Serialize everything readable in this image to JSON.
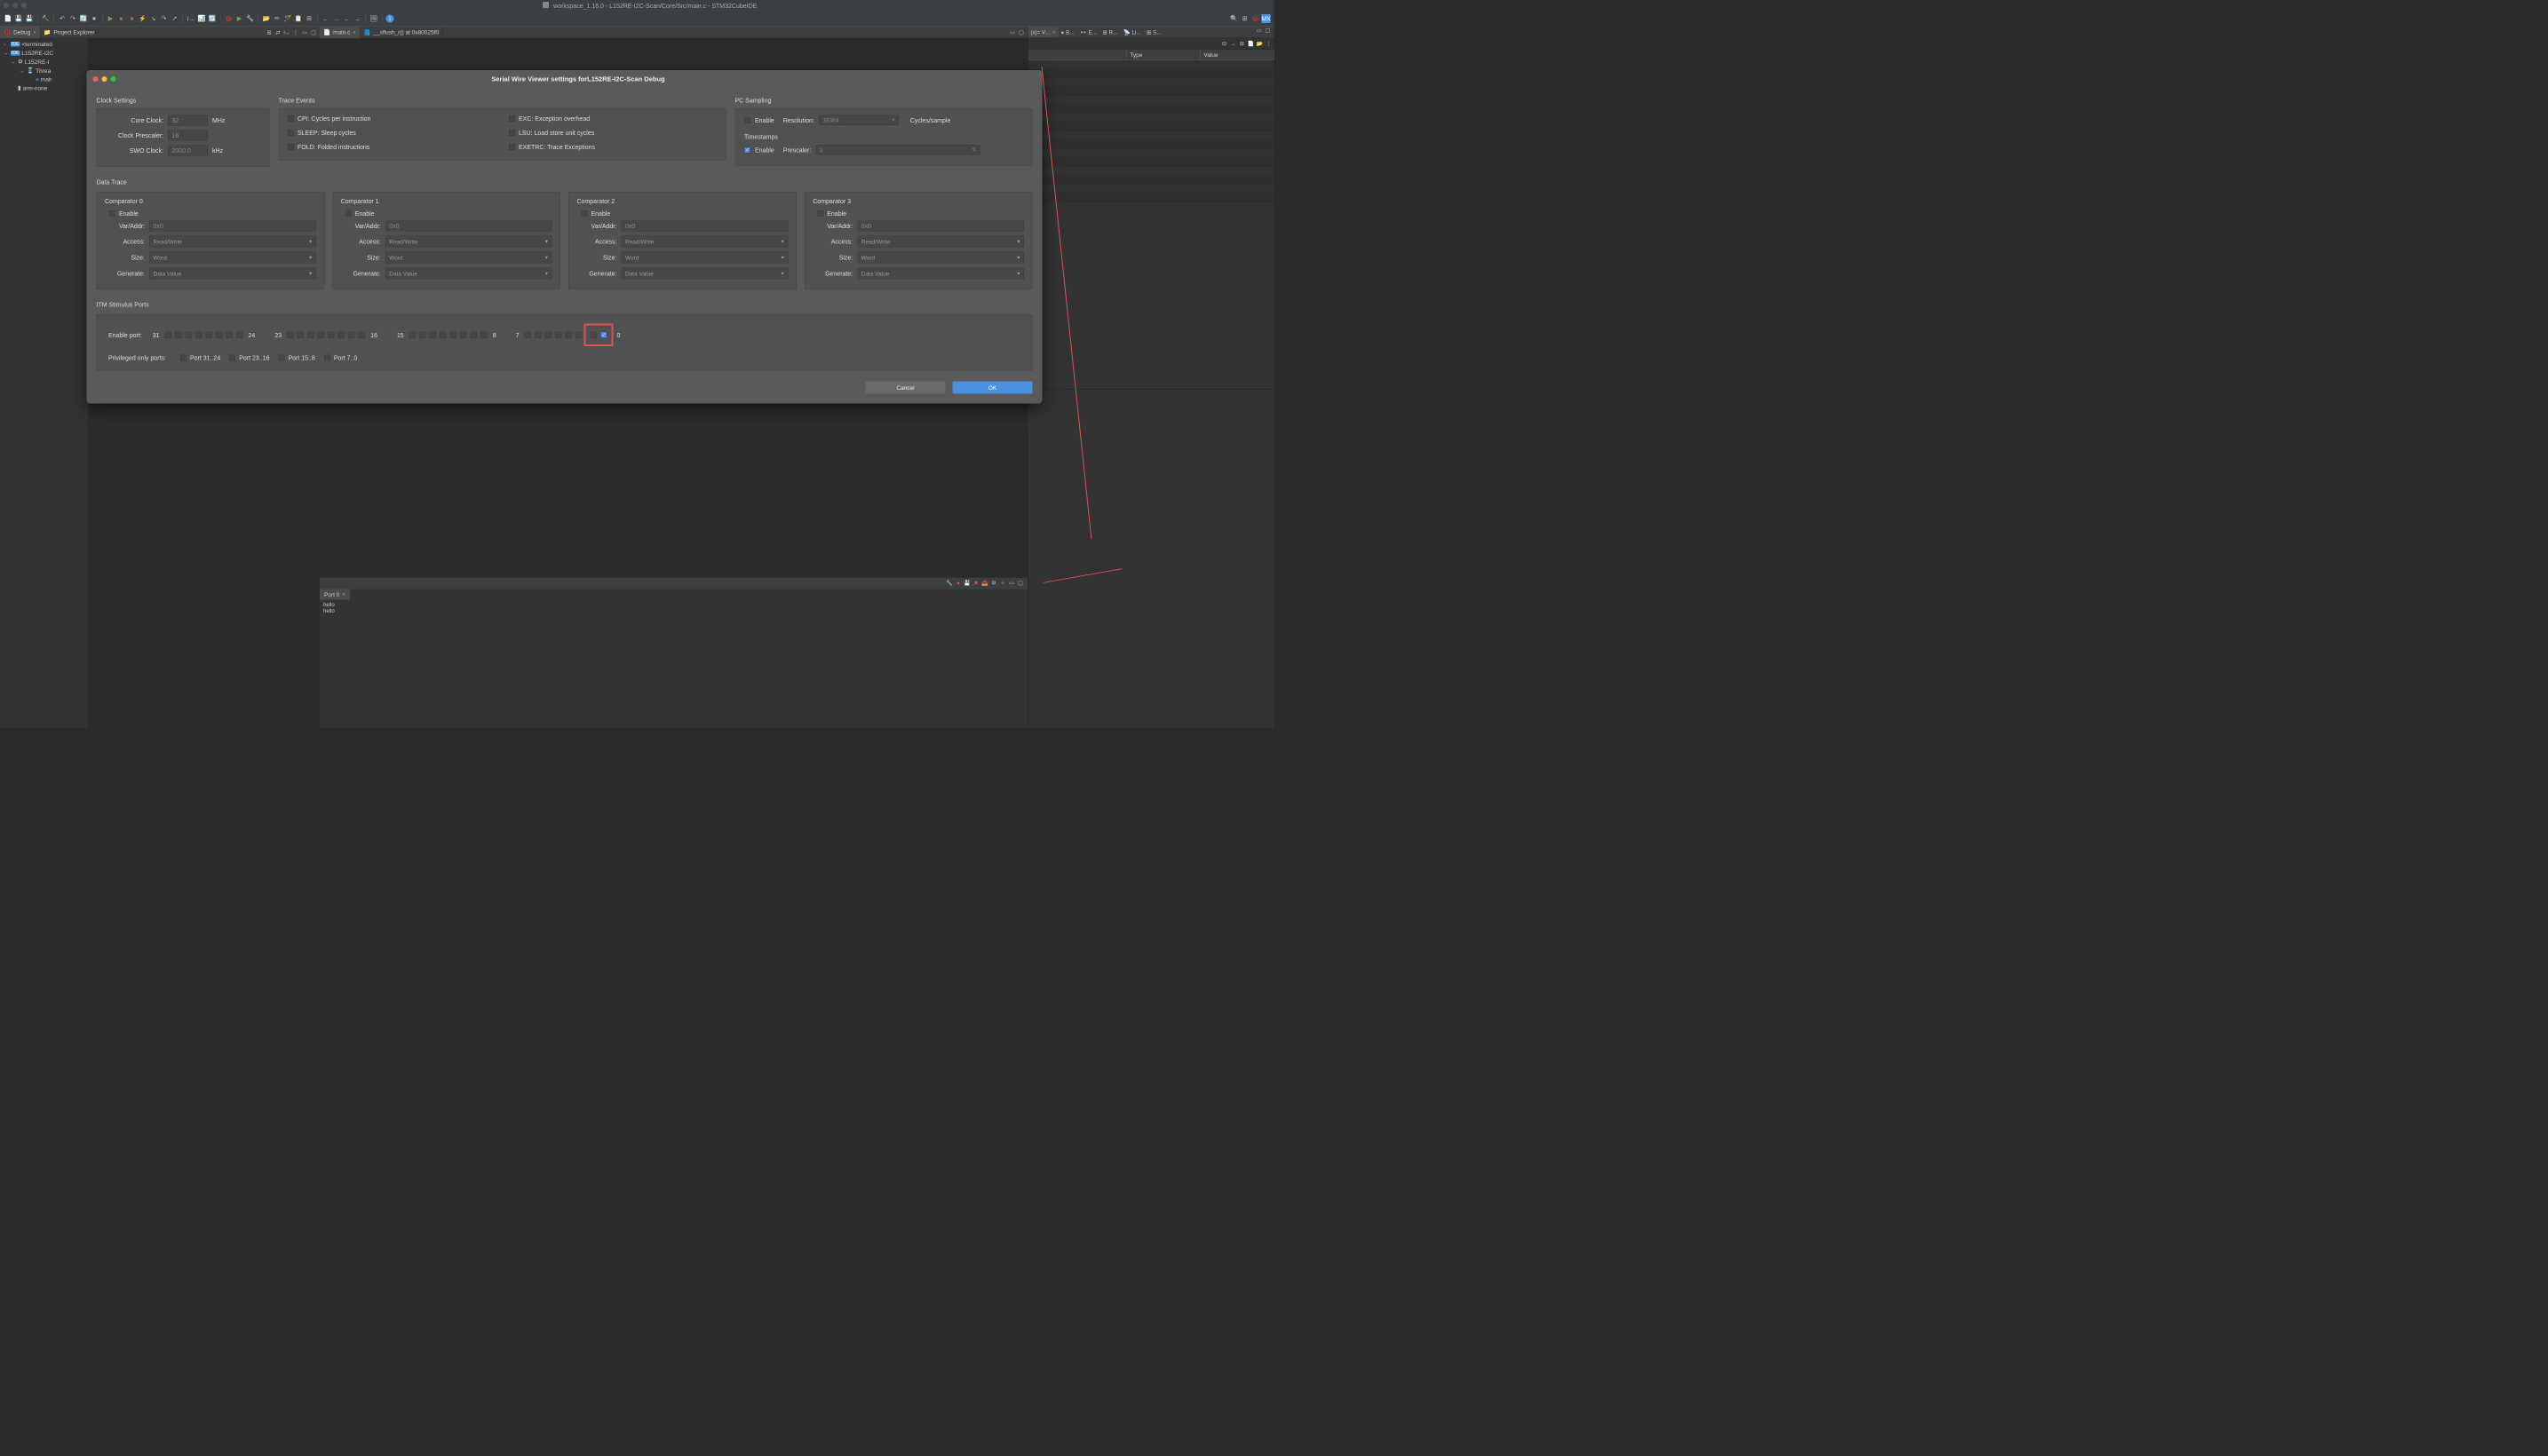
{
  "titlebar": "workspace_1.16.0 - L152RE-I2C-Scan/Core/Src/main.c - STM32CubeIDE",
  "left_tabs": {
    "debug": "Debug",
    "project_explorer": "Project Explorer"
  },
  "editor_tabs": {
    "main": "main.c",
    "sflush": "__sflush_r() at 0x80025f0"
  },
  "right_tabs": {
    "v": "V…",
    "b": "B…",
    "e": "E…",
    "r": "R…",
    "li": "Li…",
    "s": "S…"
  },
  "vars_header": {
    "c1": "",
    "c2": "Type",
    "c3": "Value"
  },
  "tree": {
    "terminated": "<terminated",
    "project": "L152RE-I2C",
    "exe": "L152RE-I",
    "thread": "Threa",
    "main": "mair",
    "arm": "arm-none"
  },
  "console_tab": "Port 0",
  "console_lines": [
    "hello",
    "hello"
  ],
  "dialog": {
    "title": "Serial Wire Viewer settings forL152RE-I2C-Scan Debug",
    "clock": {
      "section": "Clock Settings",
      "core_label": "Core Clock:",
      "core_value": "32",
      "core_unit": "MHz",
      "prescaler_label": "Clock Prescaler:",
      "prescaler_value": "16",
      "swo_label": "SWO Clock:",
      "swo_value": "2000.0",
      "swo_unit": "kHz"
    },
    "trace": {
      "section": "Trace Events",
      "cpi": "CPI: Cycles per instruction",
      "exc": "EXC: Exception overhead",
      "sleep": "SLEEP: Sleep cycles",
      "lsu": "LSU: Load store unit cycles",
      "fold": "FOLD: Folded instructions",
      "exetrc": "EXETRC: Trace Exceptions"
    },
    "pc": {
      "section": "PC Sampling",
      "enable": "Enable",
      "resolution": "Resolution:",
      "res_value": "16384",
      "suffix": "Cycles/sample"
    },
    "ts": {
      "section": "Timestamps",
      "enable": "Enable",
      "prescaler": "Prescaler:",
      "value": "1"
    },
    "data_trace": "Data Trace",
    "comp": {
      "enable": "Enable",
      "var": "Var/Addr:",
      "var_val": "0x0",
      "access": "Access:",
      "access_val": "Read/Write",
      "size": "Size:",
      "size_val": "Word",
      "generate": "Generate:",
      "generate_val": "Data Value",
      "titles": [
        "Comparator 0",
        "Comparator 1",
        "Comparator 2",
        "Comparator 3"
      ]
    },
    "itm": {
      "section": "ITM Stimulus Ports",
      "enable_port": "Enable port:",
      "priv": "Privileged only ports:",
      "p31_24": "Port 31..24",
      "p23_16": "Port 23..16",
      "p15_8": "Port 15..8",
      "p7_0": "Port 7..0",
      "n31": "31",
      "n24": "24",
      "n23": "23",
      "n16": "16",
      "n15": "15",
      "n8": "8",
      "n7": "7",
      "n0": "0"
    },
    "buttons": {
      "cancel": "Cancel",
      "ok": "OK"
    }
  }
}
